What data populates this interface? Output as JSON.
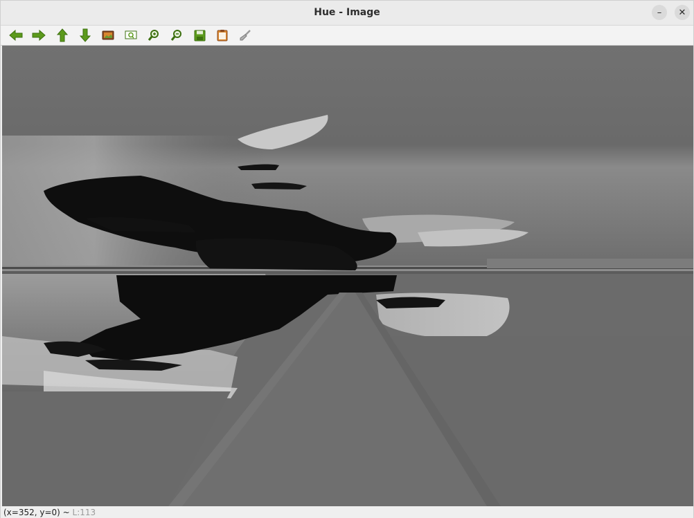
{
  "window": {
    "title": "Hue - Image",
    "minimize_glyph": "–",
    "close_glyph": "✕"
  },
  "toolbar": {
    "items": [
      {
        "icon": "arrow-left-icon",
        "tooltip": "pan left"
      },
      {
        "icon": "arrow-right-icon",
        "tooltip": "pan right"
      },
      {
        "icon": "arrow-up-icon",
        "tooltip": "pan up"
      },
      {
        "icon": "arrow-down-icon",
        "tooltip": "pan down"
      },
      {
        "icon": "image-icon",
        "tooltip": "fit image"
      },
      {
        "icon": "zoom-fit-icon",
        "tooltip": "zoom to fit"
      },
      {
        "icon": "zoom-in-icon",
        "tooltip": "zoom in"
      },
      {
        "icon": "zoom-out-icon",
        "tooltip": "zoom out"
      },
      {
        "icon": "save-icon",
        "tooltip": "save"
      },
      {
        "icon": "clipboard-icon",
        "tooltip": "copy"
      },
      {
        "icon": "brush-icon",
        "tooltip": "properties"
      }
    ]
  },
  "status": {
    "coords": "(x=352, y=0) ~",
    "level": "L:113"
  },
  "colors": {
    "icon_green": "#5c9a1c",
    "icon_green_dark": "#3d7010",
    "image_bg": "#6c6c6c"
  }
}
